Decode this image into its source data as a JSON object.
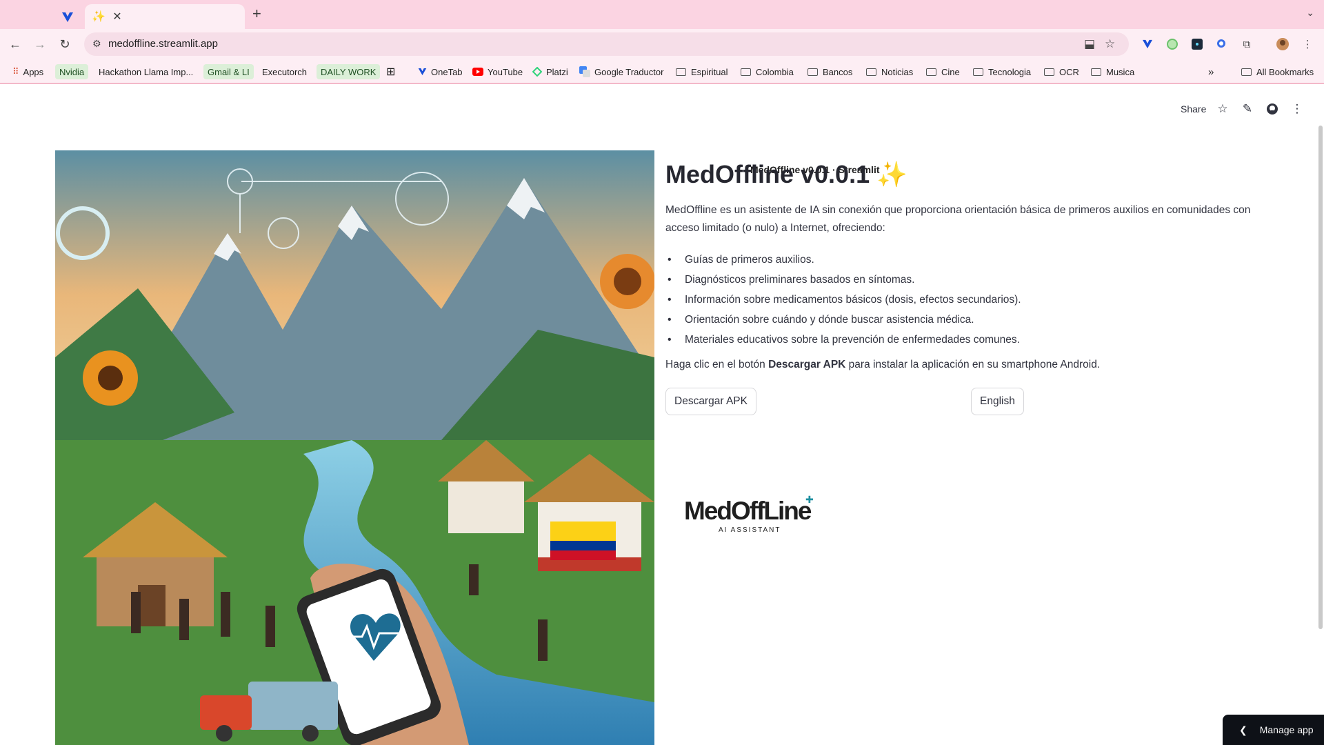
{
  "browser": {
    "active_tab_title": "MedOffline v0.0.1 · Streamlit",
    "url": "medoffline.streamlit.app",
    "bookmarks": {
      "apps": "Apps",
      "nvidia": "Nvidia",
      "hackathon": "Hackathon Llama Imp...",
      "gmail": "Gmail & LI",
      "executorch": "Executorch",
      "daily_work": "DAILY WORK",
      "onetab": "OneTab",
      "youtube": "YouTube",
      "platzi": "Platzi",
      "google_traductor": "Google Traductor",
      "espiritual": "Espiritual",
      "colombia": "Colombia",
      "bancos": "Bancos",
      "noticias": "Noticias",
      "cine": "Cine",
      "tecnologia": "Tecnologia",
      "ocr": "OCR",
      "musica": "Musica",
      "all_bookmarks": "All Bookmarks"
    }
  },
  "header": {
    "share_label": "Share"
  },
  "main": {
    "title": "MedOffline v0.0.1 ✨",
    "intro": "MedOffline es un asistente de IA sin conexión que proporciona orientación básica de primeros auxilios en comunidades con acceso limitado (o nulo) a Internet, ofreciendo:",
    "features": [
      "Guías de primeros auxilios.",
      "Diagnósticos preliminares basados en síntomas.",
      "Información sobre medicamentos básicos (dosis, efectos secundarios).",
      "Orientación sobre cuándo y dónde buscar asistencia médica.",
      "Materiales educativos sobre la prevención de enfermedades comunes."
    ],
    "instruction_before": "Haga clic en el botón ",
    "instruction_bold": "Descargar APK",
    "instruction_after": " para instalar la aplicación en su smartphone Android.",
    "download_button": "Descargar APK",
    "language_button": "English",
    "logo": {
      "word": "MedOffLine",
      "sub": "AI ASSISTANT"
    }
  },
  "footer": {
    "manage_app": "Manage app"
  },
  "colors": {
    "tabstrip": "#fbd4e2",
    "toolbar": "#fdeef4",
    "text": "#31333f",
    "manage_bg": "#0e1117"
  }
}
